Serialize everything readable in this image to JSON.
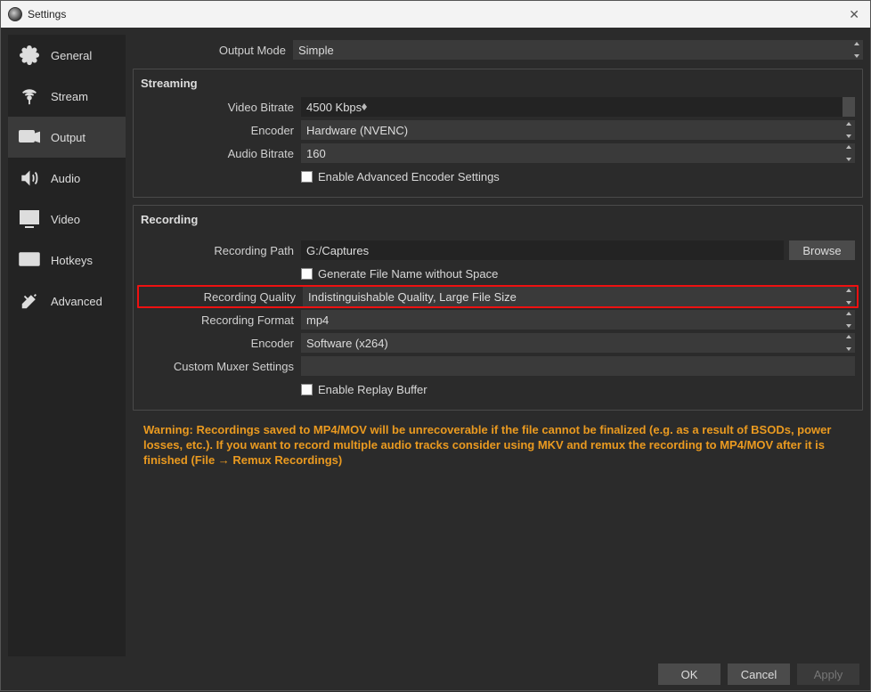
{
  "window": {
    "title": "Settings"
  },
  "sidebar": {
    "items": [
      {
        "label": "General"
      },
      {
        "label": "Stream"
      },
      {
        "label": "Output"
      },
      {
        "label": "Audio"
      },
      {
        "label": "Video"
      },
      {
        "label": "Hotkeys"
      },
      {
        "label": "Advanced"
      }
    ]
  },
  "outputMode": {
    "label": "Output Mode",
    "value": "Simple"
  },
  "streaming": {
    "title": "Streaming",
    "videoBitrate": {
      "label": "Video Bitrate",
      "value": "4500 Kbps"
    },
    "encoder": {
      "label": "Encoder",
      "value": "Hardware (NVENC)"
    },
    "audioBitrate": {
      "label": "Audio Bitrate",
      "value": "160"
    },
    "advanced": {
      "label": "Enable Advanced Encoder Settings"
    }
  },
  "recording": {
    "title": "Recording",
    "path": {
      "label": "Recording Path",
      "value": "G:/Captures",
      "browse": "Browse"
    },
    "genName": {
      "label": "Generate File Name without Space"
    },
    "quality": {
      "label": "Recording Quality",
      "value": "Indistinguishable Quality, Large File Size"
    },
    "format": {
      "label": "Recording Format",
      "value": "mp4"
    },
    "encoder": {
      "label": "Encoder",
      "value": "Software (x264)"
    },
    "muxer": {
      "label": "Custom Muxer Settings",
      "value": ""
    },
    "replay": {
      "label": "Enable Replay Buffer"
    }
  },
  "warning": "Warning: Recordings saved to MP4/MOV will be unrecoverable if the file cannot be finalized (e.g. as a result of BSODs, power losses, etc.). If you want to record multiple audio tracks consider using MKV and remux the recording to MP4/MOV after it is finished (File → Remux Recordings)",
  "footer": {
    "ok": "OK",
    "cancel": "Cancel",
    "apply": "Apply"
  }
}
